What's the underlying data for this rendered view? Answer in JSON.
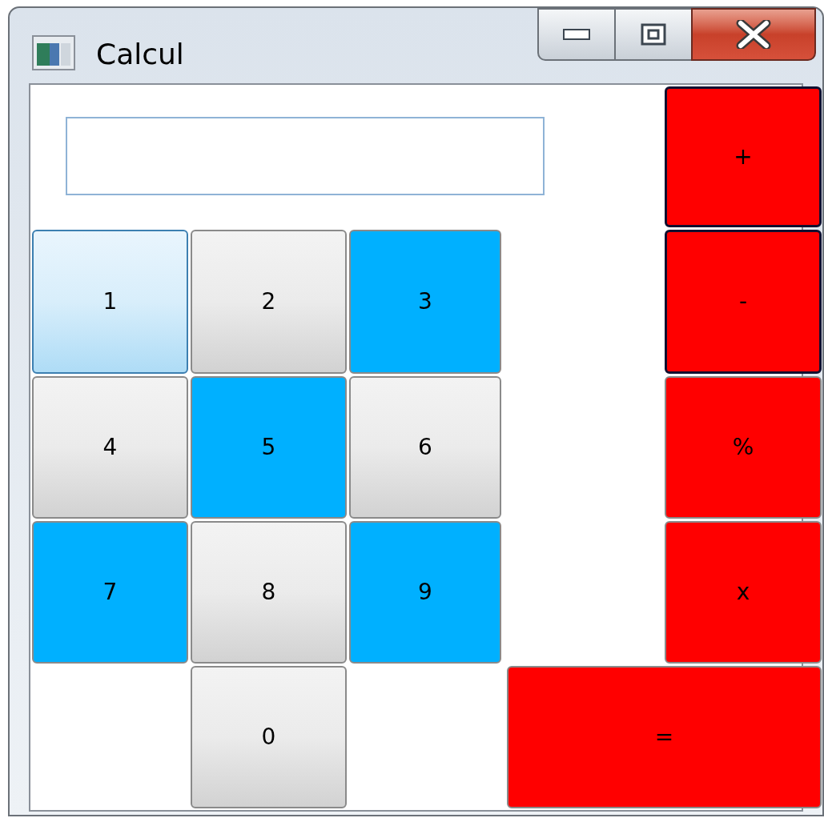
{
  "window": {
    "title": "Calcul"
  },
  "buttons": [
    {
      "label": "+",
      "kind": "red",
      "focused": true
    },
    {
      "label": "1",
      "kind": "hover",
      "focused": false
    },
    {
      "label": "2",
      "kind": "gray",
      "focused": false
    },
    {
      "label": "3",
      "kind": "cyan",
      "focused": false
    },
    {
      "label": "-",
      "kind": "red",
      "focused": true
    },
    {
      "label": "4",
      "kind": "gray",
      "focused": false
    },
    {
      "label": "5",
      "kind": "cyan",
      "focused": false
    },
    {
      "label": "6",
      "kind": "gray",
      "focused": false
    },
    {
      "label": "%",
      "kind": "red",
      "focused": false
    },
    {
      "label": "7",
      "kind": "cyan",
      "focused": false
    },
    {
      "label": "8",
      "kind": "gray",
      "focused": false
    },
    {
      "label": "9",
      "kind": "cyan",
      "focused": false
    },
    {
      "label": "x",
      "kind": "red",
      "focused": false
    },
    {
      "label": "0",
      "kind": "gray",
      "focused": false
    },
    {
      "label": "=",
      "kind": "red",
      "focused": false
    }
  ]
}
